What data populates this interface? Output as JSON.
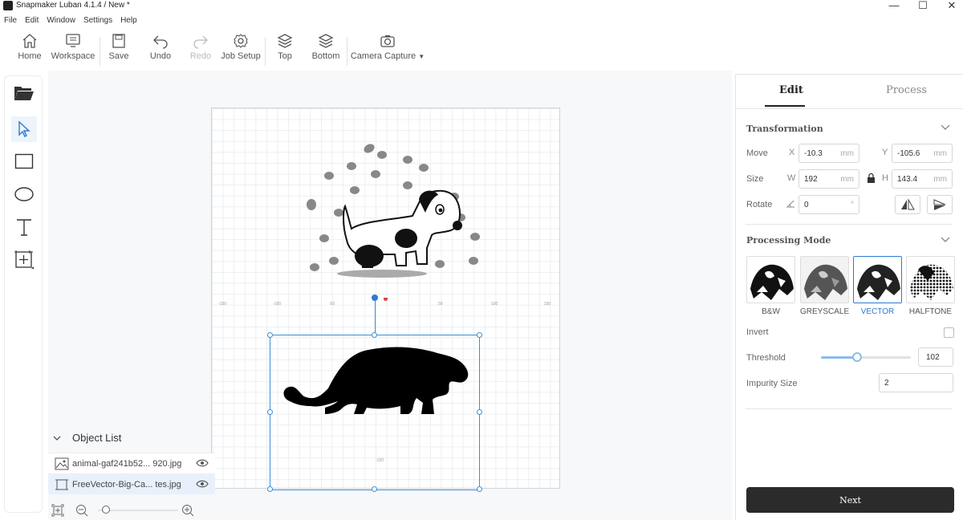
{
  "app": {
    "title": "Snapmaker Luban 4.1.4 / New *"
  },
  "window_controls": {
    "minimize": "—",
    "maximize": "☐",
    "close": "✕"
  },
  "menu": [
    "File",
    "Edit",
    "Window",
    "Settings",
    "Help"
  ],
  "toolbar": {
    "home": "Home",
    "workspace": "Workspace",
    "save": "Save",
    "undo": "Undo",
    "redo": "Redo",
    "job_setup": "Job Setup",
    "top": "Top",
    "bottom": "Bottom",
    "camera_capture": "Camera Capture"
  },
  "left_tools": [
    "folder-open-icon",
    "pointer-icon",
    "rectangle-icon",
    "ellipse-icon",
    "text-icon",
    "add-frame-icon"
  ],
  "ruler": {
    "x_labels": [
      "-150",
      "-100",
      "-50",
      "50",
      "100",
      "150"
    ],
    "y_label": "-150"
  },
  "object_list": {
    "title": "Object List",
    "items": [
      {
        "name": "animal-gaf241b52... 920.jpg",
        "type": "image"
      },
      {
        "name": "FreeVector-Big-Ca... tes.jpg",
        "type": "vector",
        "selected": true
      }
    ]
  },
  "zoom": {
    "value": 0.1
  },
  "panel": {
    "tabs": {
      "edit": "Edit",
      "process": "Process"
    },
    "transformation": {
      "title": "Transformation",
      "move_label": "Move",
      "size_label": "Size",
      "rotate_label": "Rotate",
      "x_axis": "X",
      "y_axis": "Y",
      "w_axis": "W",
      "h_axis": "H",
      "unit": "mm",
      "degree_unit": "°",
      "move_x": "-10.3",
      "move_y": "-105.6",
      "width": "192",
      "height": "143.4",
      "rotate": "0"
    },
    "processing_mode": {
      "title": "Processing Mode",
      "modes": [
        "B&W",
        "GREYSCALE",
        "VECTOR",
        "HALFTONE"
      ],
      "selected": "VECTOR",
      "invert_label": "Invert",
      "threshold_label": "Threshold",
      "threshold_value": "102",
      "threshold_fraction": 0.4,
      "impurity_label": "Impurity Size",
      "impurity_value": "2"
    },
    "next_label": "Next"
  },
  "colors": {
    "accent": "#2a7bd3",
    "dark_button": "#2b2b2b",
    "slider": "#8cbcea"
  }
}
